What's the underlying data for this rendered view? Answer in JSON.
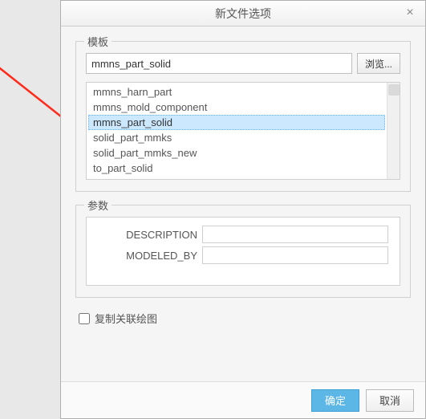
{
  "dialog": {
    "title": "新文件选项",
    "close_glyph": "×"
  },
  "template": {
    "legend": "模板",
    "input_value": "mmns_part_solid",
    "browse_label": "浏览...",
    "items": {
      "0": "mmns_harn_part",
      "1": "mmns_mold_component",
      "2": "mmns_part_solid",
      "3": "solid_part_mmks",
      "4": "solid_part_mmks_new",
      "5": "to_part_solid"
    },
    "selected_index": 2
  },
  "params": {
    "legend": "参数",
    "rows": {
      "0": {
        "label": "DESCRIPTION",
        "value": ""
      },
      "1": {
        "label": "MODELED_BY",
        "value": ""
      }
    }
  },
  "copy_checkbox": {
    "label": "复制关联绘图",
    "checked": false
  },
  "footer": {
    "ok": "确定",
    "cancel": "取消"
  },
  "annotation": {
    "arrow_color": "#ff2a1a"
  }
}
